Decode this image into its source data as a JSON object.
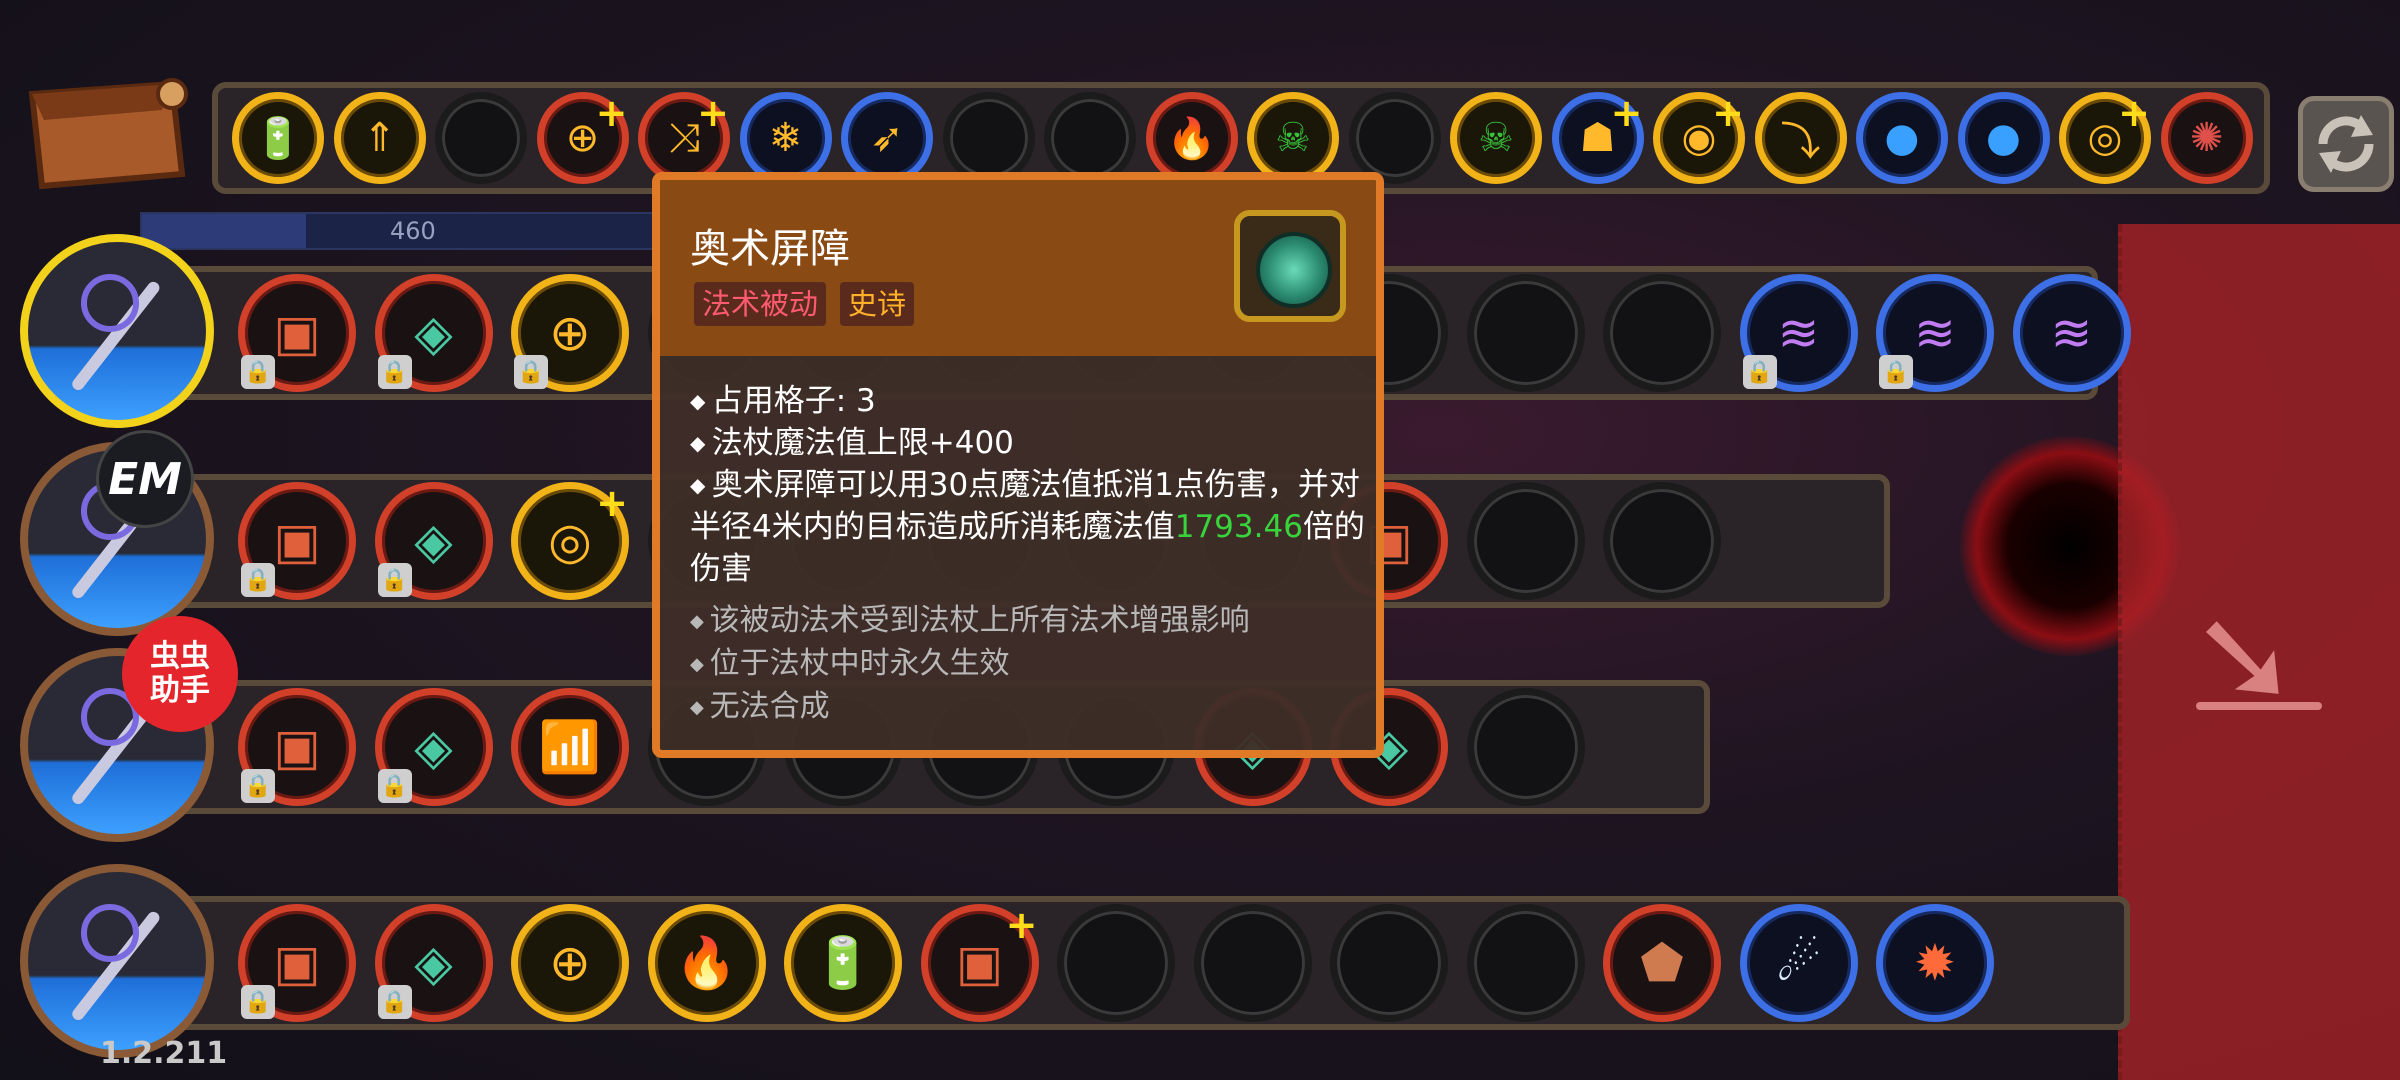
{
  "mana": {
    "value": "460",
    "fill_fraction": 0.31
  },
  "version": "1.2.211",
  "em_badge": "EM",
  "helper": {
    "line1": "虫虫",
    "line2": "助手"
  },
  "tooltip": {
    "title": "奥术屏障",
    "tags": [
      "法术被动",
      "史诗"
    ],
    "lines": [
      "占用格子: 3",
      "法杖魔法值上限+400"
    ],
    "desc_before": "奥术屏障可以用30点魔法值抵消1点伤害，并对半径4米内的目标造成所消耗魔法值",
    "desc_value": "1793.46",
    "desc_after": "倍的伤害",
    "notes": [
      "该被动法术受到法杖上所有法术增强影响",
      "位于法杖中时永久生效",
      "无法合成"
    ]
  },
  "colors": {
    "accent_orange": "#e07a26",
    "tag_passive": "#ff5a70",
    "tag_epic": "#ffb12a",
    "value_green": "#39d33c",
    "drop_zone": "#aa2228"
  },
  "inventory": [
    {
      "icon": "battery-lightning-icon",
      "ring": "gold",
      "plus": false
    },
    {
      "icon": "triple-arrow-up-icon",
      "ring": "gold",
      "plus": false
    },
    {
      "icon": "empty-slot",
      "ring": "none",
      "plus": false
    },
    {
      "icon": "crosshair-target-icon",
      "ring": "red",
      "plus": true
    },
    {
      "icon": "triple-split-arrow-icon",
      "ring": "red",
      "plus": true
    },
    {
      "icon": "ice-shard-icon",
      "ring": "blue",
      "plus": false
    },
    {
      "icon": "arrow-spear-icon",
      "ring": "blue",
      "plus": false
    },
    {
      "icon": "empty-slot",
      "ring": "none",
      "plus": false
    },
    {
      "icon": "empty-slot",
      "ring": "none",
      "plus": false
    },
    {
      "icon": "flame-fan-icon",
      "ring": "red",
      "plus": false
    },
    {
      "icon": "green-skull-icon",
      "ring": "gold",
      "plus": false
    },
    {
      "icon": "empty-slot",
      "ring": "none",
      "plus": false
    },
    {
      "icon": "green-skull-icon",
      "ring": "gold",
      "plus": false
    },
    {
      "icon": "ghost-mask-icon",
      "ring": "blue",
      "plus": true
    },
    {
      "icon": "eye-orbit-icon",
      "ring": "gold",
      "plus": true
    },
    {
      "icon": "curved-arrow-icon",
      "ring": "gold",
      "plus": false
    },
    {
      "icon": "blue-orb-icon",
      "ring": "blue",
      "plus": false
    },
    {
      "icon": "blue-orb-icon",
      "ring": "blue",
      "plus": false
    },
    {
      "icon": "target-eye-icon",
      "ring": "gold",
      "plus": true
    },
    {
      "icon": "red-brain-icon",
      "ring": "red",
      "plus": false
    }
  ],
  "wands": [
    {
      "active": true,
      "slots": [
        {
          "icon": "box-icon",
          "ring": "red",
          "lock": true
        },
        {
          "icon": "arcane-barrier-icon",
          "ring": "red",
          "lock": true
        },
        {
          "icon": "crosshair-target-icon",
          "ring": "gold",
          "lock": true
        },
        {
          "icon": "hidden",
          "ring": "none"
        },
        {
          "icon": "hidden",
          "ring": "none"
        },
        {
          "icon": "hidden",
          "ring": "none"
        },
        {
          "icon": "hidden",
          "ring": "none"
        },
        {
          "icon": "hidden",
          "ring": "none"
        },
        {
          "icon": "hidden",
          "ring": "none"
        },
        {
          "icon": "empty-slot",
          "ring": "none"
        },
        {
          "icon": "empty-slot",
          "ring": "none"
        },
        {
          "icon": "purple-wave-icon",
          "ring": "blue",
          "lock": true
        },
        {
          "icon": "purple-wave-icon",
          "ring": "blue",
          "lock": true
        },
        {
          "icon": "purple-wave-icon",
          "ring": "blue",
          "lock": false
        }
      ]
    },
    {
      "active": false,
      "slots": [
        {
          "icon": "box-icon",
          "ring": "red",
          "lock": true
        },
        {
          "icon": "arcane-barrier-icon",
          "ring": "red",
          "lock": true
        },
        {
          "icon": "target-eye-icon",
          "ring": "gold",
          "lock": false,
          "plus": true
        },
        {
          "icon": "hidden",
          "ring": "none"
        },
        {
          "icon": "hidden",
          "ring": "none"
        },
        {
          "icon": "hidden",
          "ring": "none"
        },
        {
          "icon": "hidden",
          "ring": "none"
        },
        {
          "icon": "hidden",
          "ring": "none"
        },
        {
          "icon": "box-icon",
          "ring": "red",
          "lock": false
        },
        {
          "icon": "empty-slot",
          "ring": "none"
        },
        {
          "icon": "empty-slot",
          "ring": "none"
        }
      ]
    },
    {
      "active": false,
      "slots": [
        {
          "icon": "box-icon",
          "ring": "red",
          "lock": true
        },
        {
          "icon": "arcane-barrier-icon",
          "ring": "red",
          "lock": true
        },
        {
          "icon": "signal-tower-icon",
          "ring": "red",
          "lock": false
        },
        {
          "icon": "hidden",
          "ring": "none"
        },
        {
          "icon": "hidden",
          "ring": "none"
        },
        {
          "icon": "hidden",
          "ring": "none"
        },
        {
          "icon": "hidden",
          "ring": "none"
        },
        {
          "icon": "arcane-barrier-icon",
          "ring": "red",
          "lock": false
        },
        {
          "icon": "arcane-barrier-icon",
          "ring": "red",
          "lock": false
        },
        {
          "icon": "empty-slot",
          "ring": "none"
        }
      ]
    },
    {
      "active": false,
      "slots": [
        {
          "icon": "box-icon",
          "ring": "red",
          "lock": true
        },
        {
          "icon": "arcane-barrier-icon",
          "ring": "red",
          "lock": true
        },
        {
          "icon": "crosshair-target-icon",
          "ring": "gold",
          "lock": false
        },
        {
          "icon": "flame-fan-icon",
          "ring": "gold",
          "lock": false
        },
        {
          "icon": "battery-lightning-icon",
          "ring": "gold",
          "lock": false
        },
        {
          "icon": "box-icon",
          "ring": "red",
          "lock": false,
          "plus": true
        },
        {
          "icon": "empty-slot",
          "ring": "none"
        },
        {
          "icon": "empty-slot",
          "ring": "none"
        },
        {
          "icon": "empty-slot",
          "ring": "none"
        },
        {
          "icon": "empty-slot",
          "ring": "none"
        },
        {
          "icon": "rock-icon",
          "ring": "red",
          "lock": false
        },
        {
          "icon": "ice-comet-icon",
          "ring": "blue",
          "lock": false
        },
        {
          "icon": "explosion-icon",
          "ring": "blue",
          "lock": false
        }
      ]
    }
  ]
}
